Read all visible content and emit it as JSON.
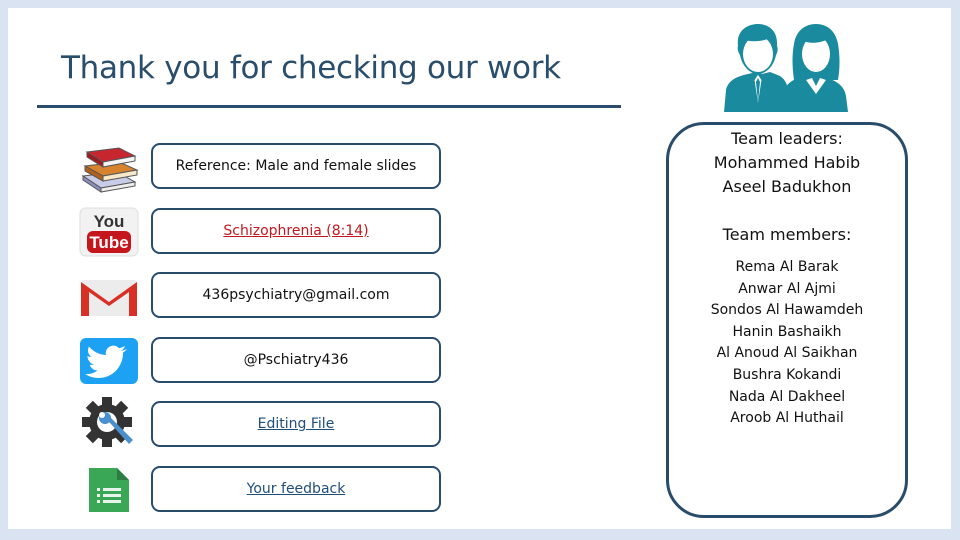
{
  "slide": {
    "title": "Thank you for checking our work",
    "colors": {
      "frame": "#dae3f1",
      "accent": "#2a4c6b",
      "team_icon": "#1a8a9e",
      "youtube_link": "#c0181e",
      "blue_link": "#1f4e79"
    }
  },
  "resources": [
    {
      "icon": "books-icon",
      "label": "Reference: Male and female slides",
      "style": "plain"
    },
    {
      "icon": "youtube-icon",
      "label": "Schizophrenia (8:14)",
      "style": "red-link"
    },
    {
      "icon": "gmail-icon",
      "label": "436psychiatry@gmail.com",
      "style": "plain"
    },
    {
      "icon": "twitter-icon",
      "label": "@Pschiatry436",
      "style": "plain"
    },
    {
      "icon": "settings-wrench-icon",
      "label": "Editing File",
      "style": "blue-link"
    },
    {
      "icon": "google-forms-icon",
      "label": "Your feedback",
      "style": "blue-link"
    }
  ],
  "team": {
    "icon": "team-people-icon",
    "leaders_label": "Team leaders:",
    "leaders": [
      "Mohammed Habib",
      "Aseel Badukhon"
    ],
    "members_label": "Team members:",
    "members": [
      "Rema Al Barak",
      "Anwar Al Ajmi",
      "Sondos Al Hawamdeh",
      "Hanin Bashaikh",
      "Al Anoud Al Saikhan",
      "Bushra Kokandi",
      "Nada Al Dakheel",
      "Aroob Al Huthail"
    ]
  }
}
